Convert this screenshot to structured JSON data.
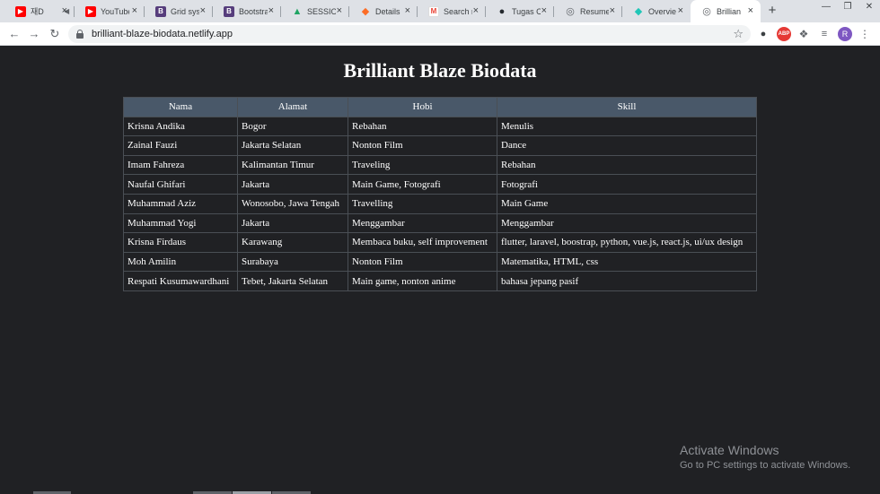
{
  "browser": {
    "tabs": [
      {
        "label": "재D",
        "icon": "youtube-icon",
        "color": "#ff0000",
        "muted": true
      },
      {
        "label": "YouTube",
        "icon": "youtube-icon",
        "color": "#ff0000"
      },
      {
        "label": "Grid sys",
        "icon": "bootstrap-icon",
        "color": "#563d7c"
      },
      {
        "label": "Bootstra",
        "icon": "bootstrap-icon",
        "color": "#563d7c"
      },
      {
        "label": "SESSION",
        "icon": "drive-icon",
        "color": "#1fa463"
      },
      {
        "label": "Details",
        "icon": "gitlab-icon",
        "color": "#fc6d26"
      },
      {
        "label": "Search r",
        "icon": "gmail-icon",
        "color": "#ea4335"
      },
      {
        "label": "Tugas C",
        "icon": "github-icon",
        "color": "#24292e"
      },
      {
        "label": "Resume",
        "icon": "globe-icon",
        "color": "#5f6368"
      },
      {
        "label": "Overvie",
        "icon": "netlify-icon",
        "color": "#20c6b7"
      },
      {
        "label": "Brillian",
        "icon": "globe-icon",
        "color": "#5f6368",
        "active": true
      }
    ],
    "url": "brilliant-blaze-biodata.netlify.app",
    "avatar_letter": "R",
    "abp_label": "ABP"
  },
  "page": {
    "title": "Brilliant Blaze Biodata",
    "table": {
      "headers": [
        "Nama",
        "Alamat",
        "Hobi",
        "Skill"
      ],
      "rows": [
        [
          "Krisna Andika",
          "Bogor",
          "Rebahan",
          "Menulis"
        ],
        [
          "Zainal Fauzi",
          "Jakarta Selatan",
          "Nonton Film",
          "Dance"
        ],
        [
          "Imam Fahreza",
          "Kalimantan Timur",
          "Traveling",
          "Rebahan"
        ],
        [
          "Naufal Ghifari",
          "Jakarta",
          "Main Game, Fotografi",
          "Fotografi"
        ],
        [
          "Muhammad Aziz",
          "Wonosobo, Jawa Tengah",
          "Travelling",
          "Main Game"
        ],
        [
          "Muhammad Yogi",
          "Jakarta",
          "Menggambar",
          "Menggambar"
        ],
        [
          "Krisna Firdaus",
          "Karawang",
          "Membaca buku, self improvement",
          "flutter, laravel, boostrap, python, vue.js, react.js, ui/ux design"
        ],
        [
          "Moh Amilin",
          "Surabaya",
          "Nonton Film",
          "Matematika, HTML, css"
        ],
        [
          "Respati Kusumawardhani",
          "Tebet, Jakarta Selatan",
          "Main game, nonton anime",
          "bahasa jepang pasif"
        ]
      ]
    }
  },
  "watermark": {
    "line1": "Activate Windows",
    "line2": "Go to PC settings to activate Windows."
  }
}
